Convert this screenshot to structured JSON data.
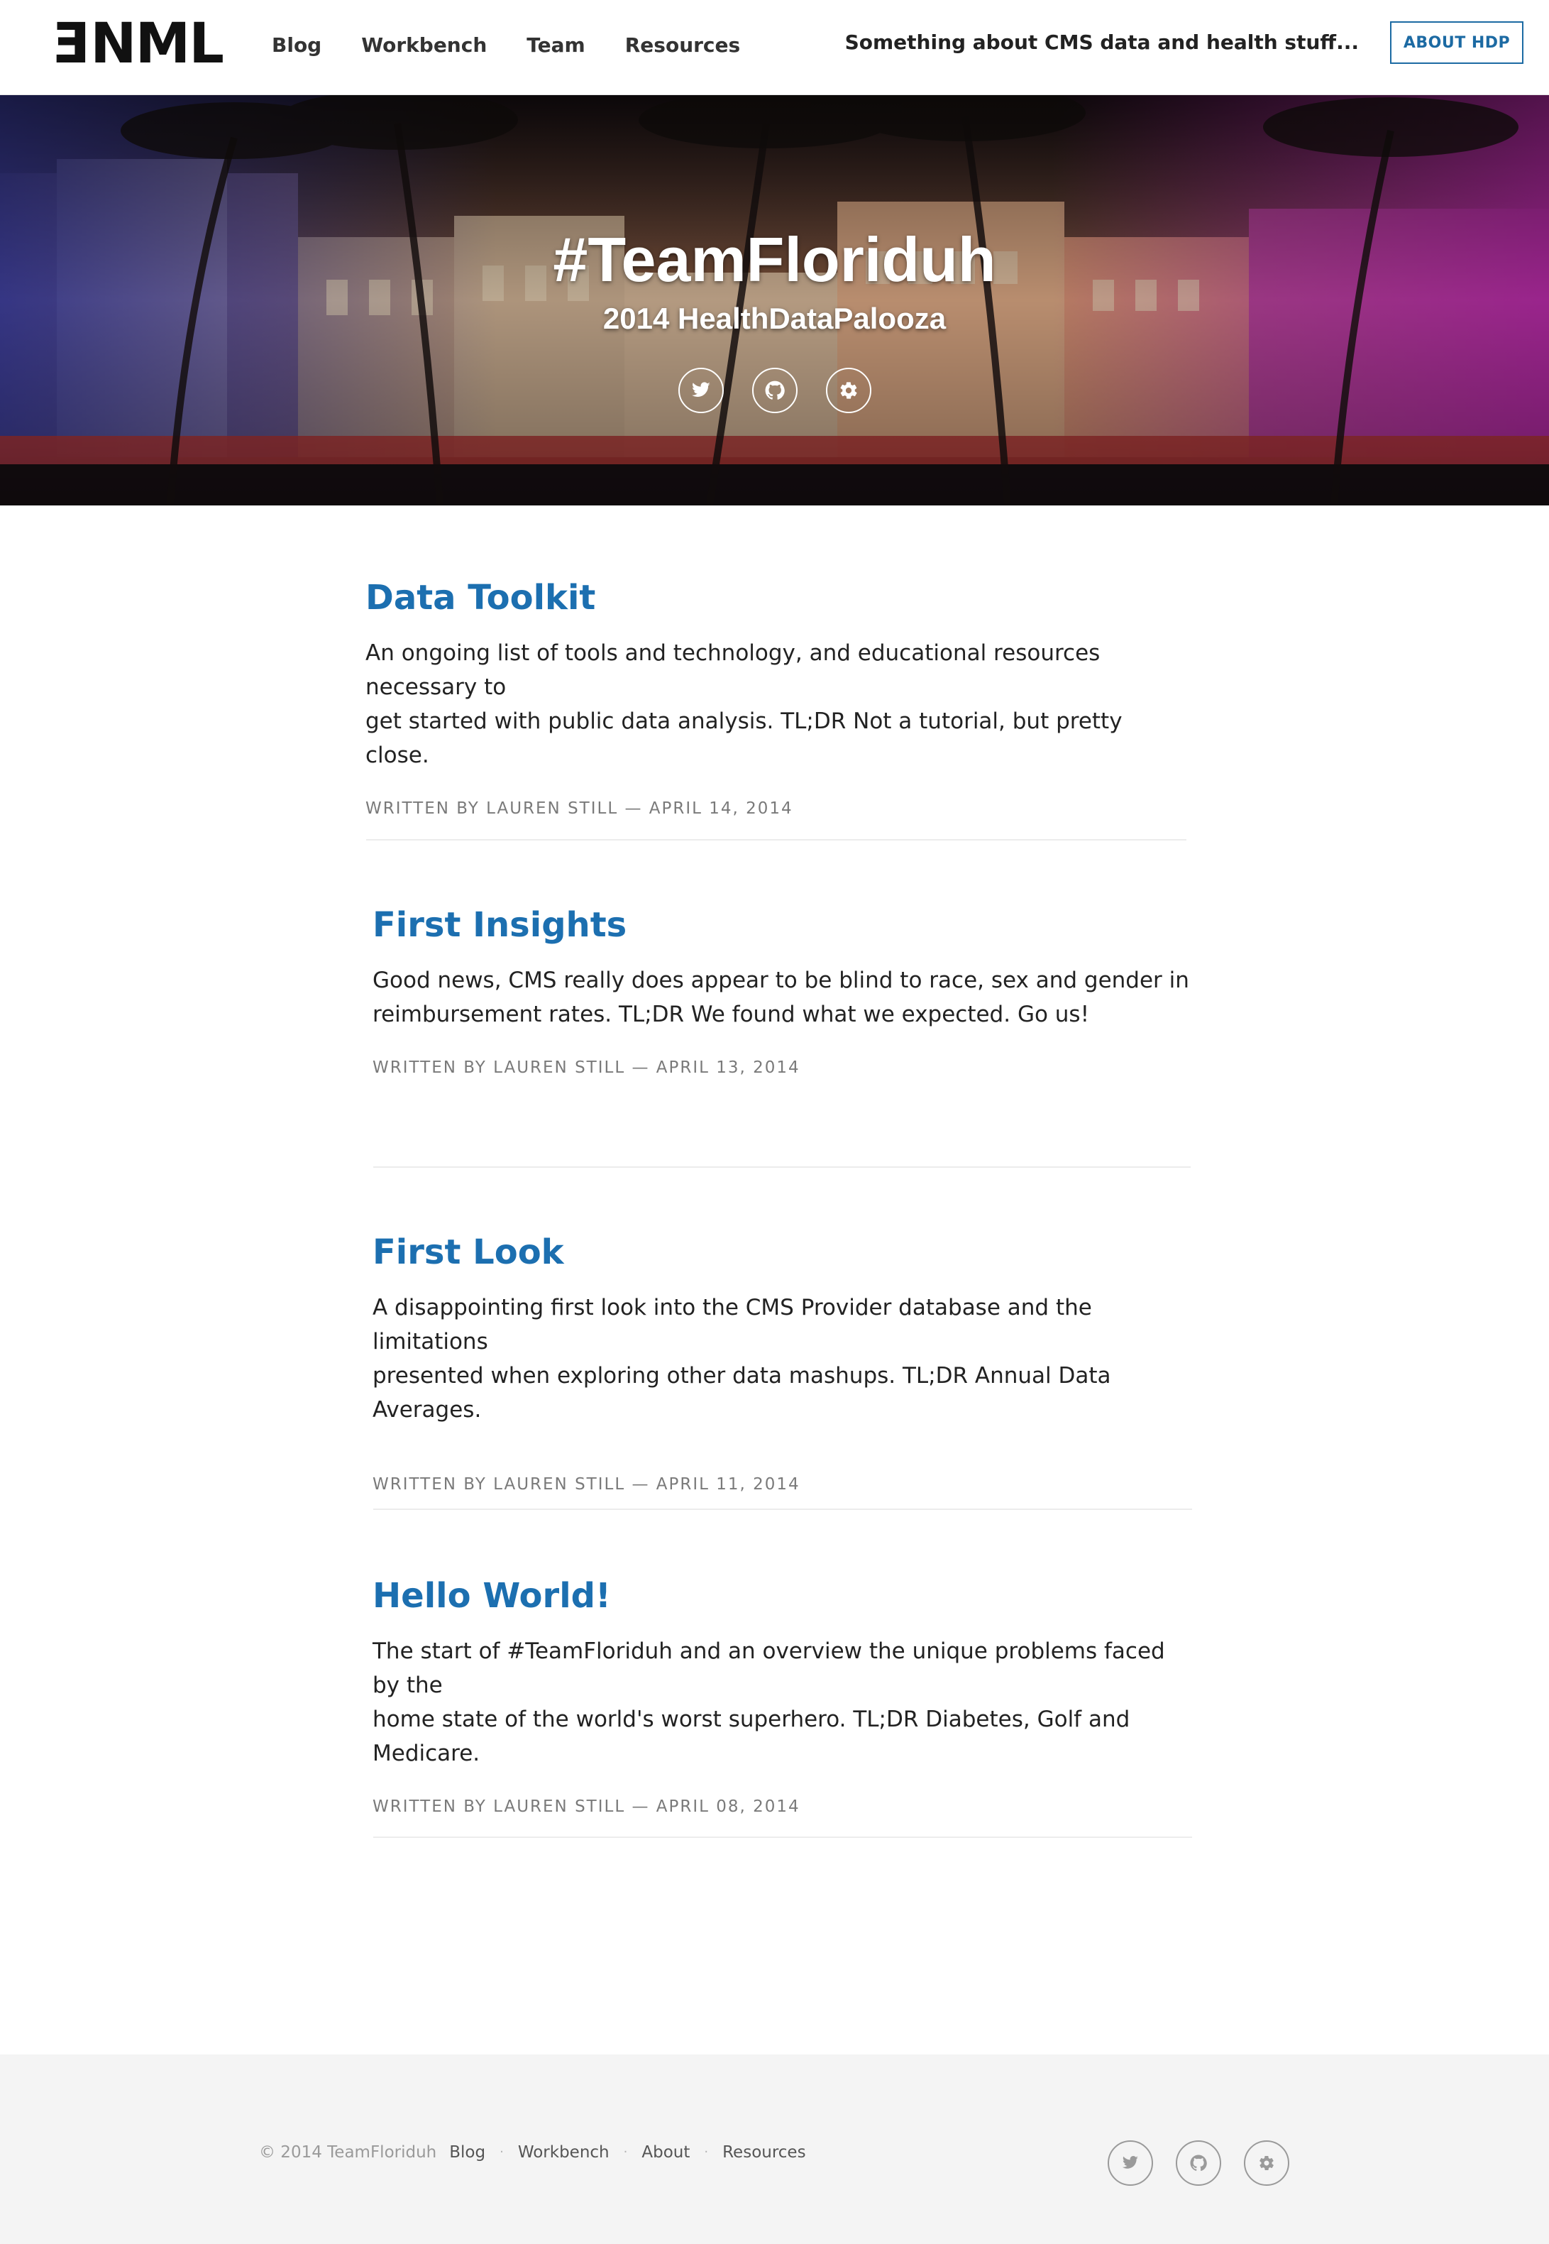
{
  "header": {
    "logo_text": "FNML",
    "nav": [
      "Blog",
      "Workbench",
      "Team",
      "Resources"
    ],
    "tagline": "Something about CMS data and health stuff...",
    "about_button": "ABOUT HDP"
  },
  "hero": {
    "title": "#TeamFloriduh",
    "subtitle": "2014 HealthDataPalooza",
    "icons": [
      "twitter-icon",
      "github-icon",
      "gear-icon"
    ]
  },
  "posts": [
    {
      "title": "Data Toolkit",
      "excerpt_line1": "An ongoing list of tools and technology, and educational resources necessary to",
      "excerpt_line2": "get started with public data analysis. TL;DR Not a tutorial, but pretty close.",
      "meta": "WRITTEN BY LAUREN STILL — APRIL 14, 2014"
    },
    {
      "title": "First Insights",
      "excerpt_line1": "Good news, CMS really does appear to be blind to race, sex and gender in",
      "excerpt_line2": "reimbursement rates. TL;DR We found what we expected. Go us!",
      "meta": "WRITTEN BY LAUREN STILL — APRIL 13, 2014"
    },
    {
      "title": "First Look",
      "excerpt_line1": "A disappointing first look into the CMS Provider database and the limitations",
      "excerpt_line2": "presented when exploring other data mashups. TL;DR Annual Data Averages.",
      "meta": "WRITTEN BY LAUREN STILL — APRIL 11, 2014"
    },
    {
      "title": "Hello World!",
      "excerpt_line1": "The start of #TeamFloriduh and an overview the unique problems faced by the",
      "excerpt_line2": "home state of the world's worst superhero. TL;DR Diabetes, Golf and Medicare.",
      "meta": "WRITTEN BY LAUREN STILL — APRIL 08, 2014"
    }
  ],
  "footer": {
    "copyright": "© 2014 TeamFloriduh",
    "links": [
      "Blog",
      "Workbench",
      "About",
      "Resources"
    ],
    "separator": "·",
    "icons": [
      "twitter-icon",
      "github-icon",
      "gear-icon"
    ]
  },
  "colors": {
    "accent": "#1c6fb0",
    "button_border": "#1c6aa3",
    "meta_text": "#7a7a7a",
    "footer_bg": "#f4f4f4"
  }
}
